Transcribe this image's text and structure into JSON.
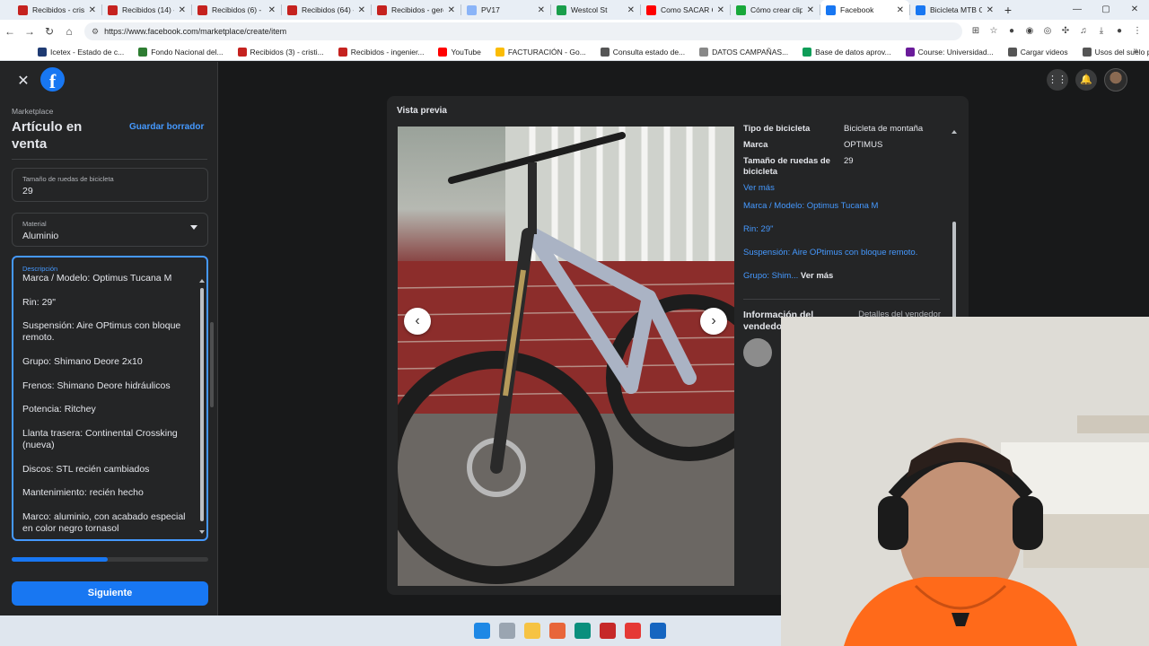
{
  "browser": {
    "tabs": [
      {
        "label": "Recibidos - crist",
        "color": "#c5221f"
      },
      {
        "label": "Recibidos (14) -",
        "color": "#c5221f"
      },
      {
        "label": "Recibidos (6) - in",
        "color": "#c5221f"
      },
      {
        "label": "Recibidos (64) -",
        "color": "#c5221f"
      },
      {
        "label": "Recibidos - gere",
        "color": "#c5221f"
      },
      {
        "label": "PV17",
        "color": "#8ab4f8"
      },
      {
        "label": "Westcol St",
        "color": "#1a9e4b"
      },
      {
        "label": "Como SACAR Cl",
        "color": "#ff0000"
      },
      {
        "label": "Cómo crear clip",
        "color": "#18a83a"
      },
      {
        "label": "Facebook",
        "color": "#1877f2",
        "active": true
      },
      {
        "label": "Bicicleta MTB Op",
        "color": "#1877f2"
      }
    ],
    "url": "https://www.facebook.com/marketplace/create/item",
    "bookmarks": [
      {
        "label": "Icetex - Estado de c...",
        "color": "#1f3b73"
      },
      {
        "label": "Fondo Nacional del...",
        "color": "#2e7d32"
      },
      {
        "label": "Recibidos (3) - cristi...",
        "color": "#c5221f"
      },
      {
        "label": "Recibidos - ingenier...",
        "color": "#c5221f"
      },
      {
        "label": "YouTube",
        "color": "#ff0000"
      },
      {
        "label": "FACTURACIÓN - Go...",
        "color": "#fbbc04"
      },
      {
        "label": "Consulta estado de...",
        "color": "#555555"
      },
      {
        "label": "DATOS CAMPAÑAS...",
        "color": "#888888"
      },
      {
        "label": "Base de datos aprov...",
        "color": "#0f9d58"
      },
      {
        "label": "Course: Universidad...",
        "color": "#6a1b9a"
      },
      {
        "label": "Cargar videos",
        "color": "#555555"
      },
      {
        "label": "Usos del suelo palm...",
        "color": "#555555"
      }
    ]
  },
  "left_panel": {
    "breadcrumb": "Marketplace",
    "title": "Artículo en venta",
    "save_draft": "Guardar borrador",
    "wheel_size": {
      "label": "Tamaño de ruedas de bicicleta",
      "value": "29"
    },
    "material": {
      "label": "Material",
      "value": "Aluminio"
    },
    "description": {
      "label": "Descripción",
      "lines": [
        "Marca / Modelo: Optimus Tucana M",
        "Rin: 29\"",
        "Suspensión: Aire OPtimus con bloque remoto.",
        "Grupo: Shimano Deore 2x10",
        "Frenos: Shimano Deore hidráulicos",
        "Potencia: Ritchey",
        "Llanta trasera: Continental Crossking (nueva)",
        "Discos: STL recién cambiados",
        "Mantenimiento: recién hecho",
        "Marco: aluminio, con acabado especial en color negro tornasol"
      ]
    },
    "progress": 0.49,
    "next_button": "Siguiente"
  },
  "preview": {
    "title": "Vista previa",
    "specs": [
      {
        "key": "Tipo de bicicleta",
        "value": "Bicicleta de montaña"
      },
      {
        "key": "Marca",
        "value": "OPTIMUS"
      },
      {
        "key": "Tamaño de ruedas de bicicleta",
        "value": "29"
      }
    ],
    "see_more": "Ver más",
    "desc_lines": [
      "Marca / Modelo: Optimus Tucana M",
      "Rin: 29\"",
      "Suspensión: Aire OPtimus con bloque remoto."
    ],
    "desc_last": "Grupo: Shim...",
    "desc_more": "Ver más",
    "seller_title": "Información del vendedor",
    "seller_details": "Detalles del vendedor"
  },
  "accent": "#1877f2",
  "link_color": "#4599ff"
}
